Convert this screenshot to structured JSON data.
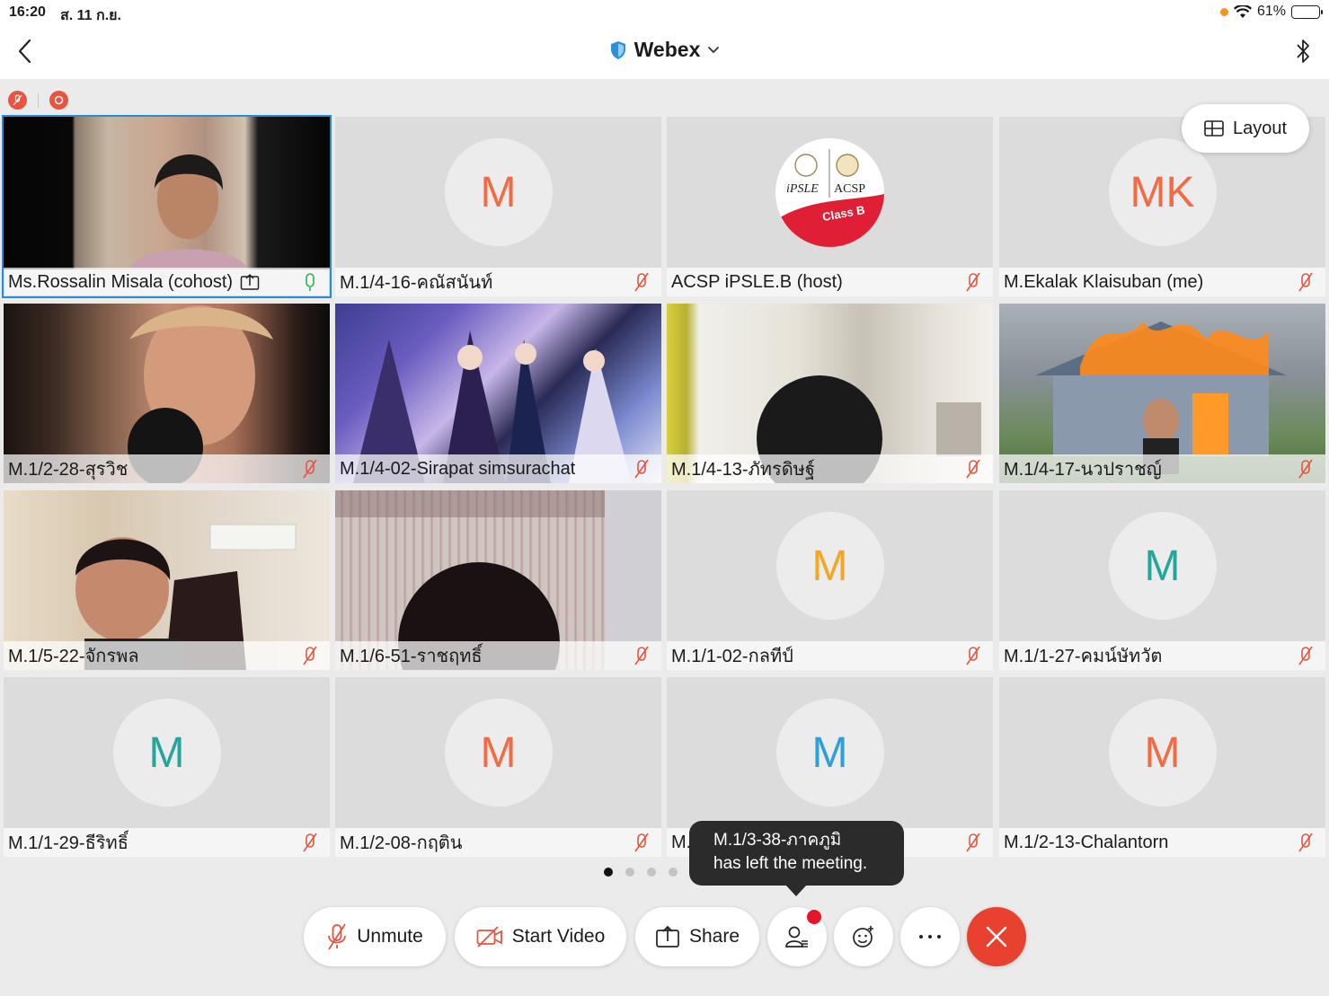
{
  "status": {
    "time": "16:20",
    "date": "ส. 11 ก.ย.",
    "battery": "61%",
    "battery_level": 0.61
  },
  "header": {
    "title": "Webex",
    "back_icon": "chevron-left-icon",
    "bluetooth_icon": "bluetooth-icon"
  },
  "layout_button": {
    "label": "Layout"
  },
  "tiles": [
    {
      "name": "Ms.Rossalin Misala (cohost)",
      "type": "video",
      "active": true,
      "sharing": true,
      "mic": "on"
    },
    {
      "name": "M.1/4-16-คณัสนันท์",
      "type": "avatar",
      "initials": "M",
      "color": "#f26b43",
      "mic": "muted"
    },
    {
      "name": "ACSP iPSLE.B (host)",
      "type": "logo",
      "logo_text": [
        "iPSLE",
        "ACSP",
        "Class B"
      ],
      "mic": "muted"
    },
    {
      "name": "M.Ekalak Klaisuban (me)",
      "type": "avatar",
      "initials": "MK",
      "color": "#f26b43",
      "mic": "muted"
    },
    {
      "name": "M.1/2-28-สุรวิช",
      "type": "video",
      "mic": "muted"
    },
    {
      "name": "M.1/4-02-Sirapat simsurachat",
      "type": "video",
      "mic": "muted"
    },
    {
      "name": "M.1/4-13-ภัทรดิษฐ์",
      "type": "video",
      "mic": "muted"
    },
    {
      "name": "M.1/4-17-นวปราชญ์",
      "type": "video",
      "mic": "muted"
    },
    {
      "name": "M.1/5-22-จักรพล",
      "type": "video",
      "mic": "muted"
    },
    {
      "name": "M.1/6-51-ราชฤทธิ์",
      "type": "video",
      "mic": "muted"
    },
    {
      "name": "M.1/1-02-กลทีป์",
      "type": "avatar",
      "initials": "M",
      "color": "#f5a623",
      "mic": "muted"
    },
    {
      "name": "M.1/1-27-คมน์ษัทวัต",
      "type": "avatar",
      "initials": "M",
      "color": "#26a69a",
      "mic": "muted"
    },
    {
      "name": "M.1/1-29-ธีริทธิ์",
      "type": "avatar",
      "initials": "M",
      "color": "#26a69a",
      "mic": "muted"
    },
    {
      "name": "M.1/2-08-กฤติน",
      "type": "avatar",
      "initials": "M",
      "color": "#f26b43",
      "mic": "muted"
    },
    {
      "name": "M.1/2-...",
      "type": "avatar",
      "initials": "M",
      "color": "#2e9fd8",
      "mic": "muted"
    },
    {
      "name": "M.1/2-13-Chalantorn",
      "type": "avatar",
      "initials": "M",
      "color": "#f26b43",
      "mic": "muted"
    }
  ],
  "pagination": {
    "pages": 4,
    "current": 1
  },
  "toast": {
    "line1": "M.1/3-38-ภาคภูมิ",
    "line2": "has left the meeting."
  },
  "toolbar": {
    "unmute": "Unmute",
    "start_video": "Start Video",
    "share": "Share"
  },
  "colors": {
    "accent_blue": "#2a8bd0",
    "leave_red": "#e8412f",
    "notice_red": "#e5152a",
    "mute_red": "#e8543f",
    "mic_green": "#2bb24c"
  }
}
